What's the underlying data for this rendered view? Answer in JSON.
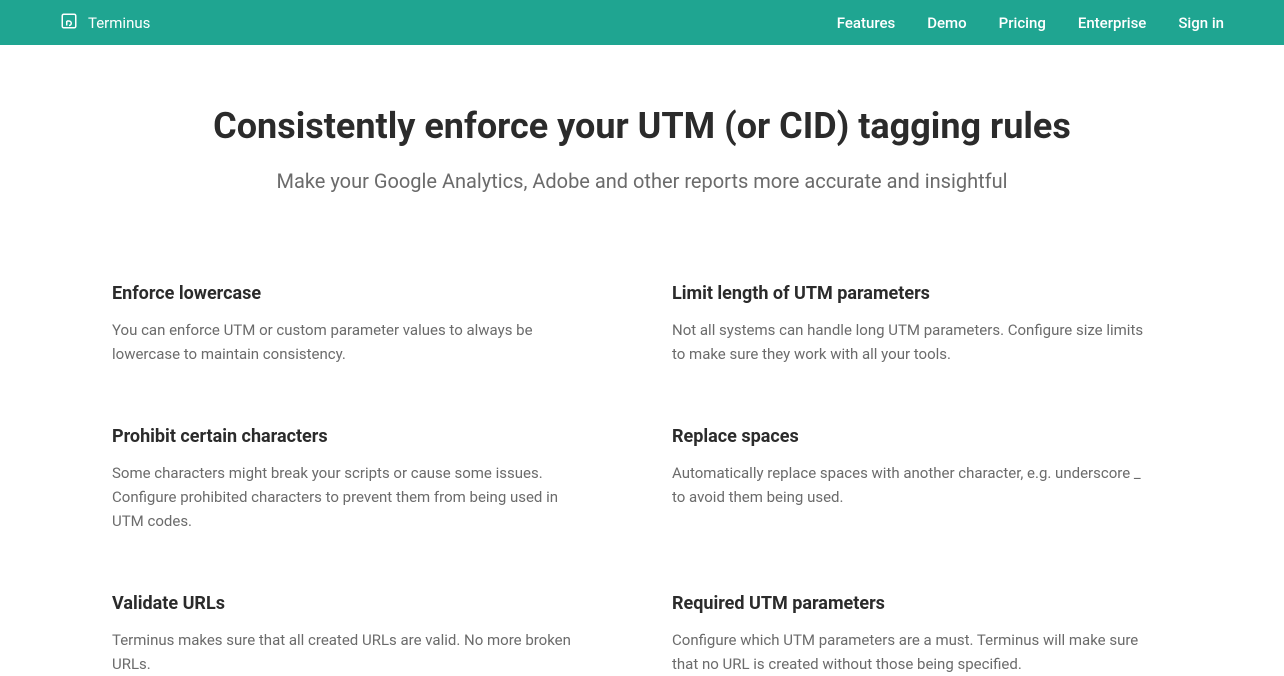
{
  "nav": {
    "brand": "Terminus",
    "links": [
      "Features",
      "Demo",
      "Pricing",
      "Enterprise",
      "Sign in"
    ]
  },
  "hero": {
    "title": "Consistently enforce your UTM (or CID) tagging rules",
    "subtitle": "Make your Google Analytics, Adobe and other reports more accurate and insightful"
  },
  "features": [
    {
      "title": "Enforce lowercase",
      "body": "You can enforce UTM or custom parameter values to always be lowercase to maintain consistency."
    },
    {
      "title": "Limit length of UTM parameters",
      "body": "Not all systems can handle long UTM parameters. Configure size limits to make sure they work with all your tools."
    },
    {
      "title": "Prohibit certain characters",
      "body": "Some characters might break your scripts or cause some issues. Configure prohibited characters to prevent them from being used in UTM codes."
    },
    {
      "title": "Replace spaces",
      "body": "Automatically replace spaces with another character, e.g. underscore _ to avoid them being used."
    },
    {
      "title": "Validate URLs",
      "body": "Terminus makes sure that all created URLs are valid. No more broken URLs."
    },
    {
      "title": "Required UTM parameters",
      "body": "Configure which UTM parameters are a must. Terminus will make sure that no URL is created without those being specified."
    }
  ]
}
